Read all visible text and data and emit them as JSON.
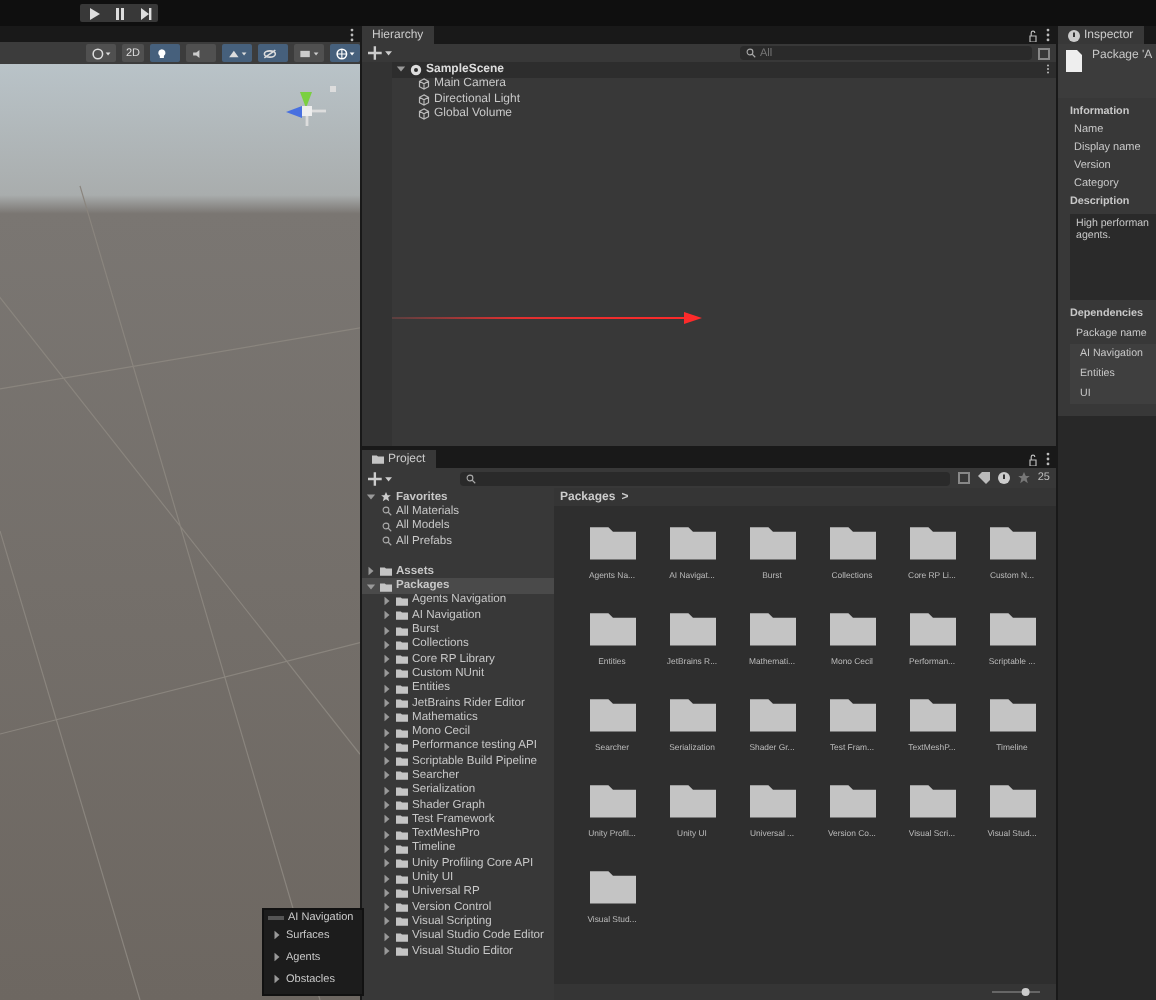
{
  "scene_view": {
    "toolbar": [
      {
        "kind": "shading",
        "on": false
      },
      {
        "kind": "mode",
        "label": "2D",
        "on": false
      },
      {
        "kind": "lighting",
        "on": true
      },
      {
        "kind": "audio",
        "on": false
      },
      {
        "kind": "effects",
        "on": true
      },
      {
        "kind": "visibility",
        "on": true
      },
      {
        "kind": "camera",
        "on": false
      },
      {
        "kind": "gizmos",
        "on": true
      }
    ],
    "overlay": {
      "title": "AI Navigation",
      "items": [
        "Surfaces",
        "Agents",
        "Obstacles"
      ]
    }
  },
  "hierarchy": {
    "tab": "Hierarchy",
    "search_placeholder": "All",
    "scene": "SampleScene",
    "objects": [
      "Main Camera",
      "Directional Light",
      "Global Volume"
    ]
  },
  "inspector": {
    "tab": "Inspector",
    "header": "Package 'A",
    "information": {
      "title": "Information",
      "fields": [
        "Name",
        "Display name",
        "Version",
        "Category"
      ]
    },
    "description": {
      "title": "Description",
      "lines": [
        "High performan",
        "agents."
      ]
    },
    "dependencies": {
      "title": "Dependencies",
      "column": "Package name",
      "rows": [
        "AI Navigation",
        "Entities",
        "UI"
      ]
    }
  },
  "project": {
    "tab": "Project",
    "hidden_count": "25",
    "favorites": {
      "label": "Favorites",
      "expanded": true,
      "items": [
        "All Materials",
        "All Models",
        "All Prefabs"
      ]
    },
    "roots": [
      {
        "label": "Assets",
        "expanded": false,
        "selected": false
      },
      {
        "label": "Packages",
        "expanded": true,
        "selected": true,
        "children": [
          "Agents Navigation",
          "AI Navigation",
          "Burst",
          "Collections",
          "Core RP Library",
          "Custom NUnit",
          "Entities",
          "JetBrains Rider Editor",
          "Mathematics",
          "Mono Cecil",
          "Performance testing API",
          "Scriptable Build Pipeline",
          "Searcher",
          "Serialization",
          "Shader Graph",
          "Test Framework",
          "TextMeshPro",
          "Timeline",
          "Unity Profiling Core API",
          "Unity UI",
          "Universal RP",
          "Version Control",
          "Visual Scripting",
          "Visual Studio Code Editor",
          "Visual Studio Editor"
        ]
      }
    ],
    "zoom_slider": {
      "level": 0.7
    },
    "breadcrumb": "Packages",
    "breadcrumb_separator": ">",
    "folders": [
      "Agents Na...",
      "AI Navigat...",
      "Burst",
      "Collections",
      "Core RP Li...",
      "Custom N...",
      "Entities",
      "JetBrains R...",
      "Mathemati...",
      "Mono Cecil",
      "Performan...",
      "Scriptable ...",
      "Searcher",
      "Serialization",
      "Shader Gr...",
      "Test Fram...",
      "TextMeshP...",
      "Timeline",
      "Unity Profil...",
      "Unity UI",
      "Universal ...",
      "Version Co...",
      "Visual Scri...",
      "Visual Stud...",
      "Visual Stud..."
    ]
  }
}
